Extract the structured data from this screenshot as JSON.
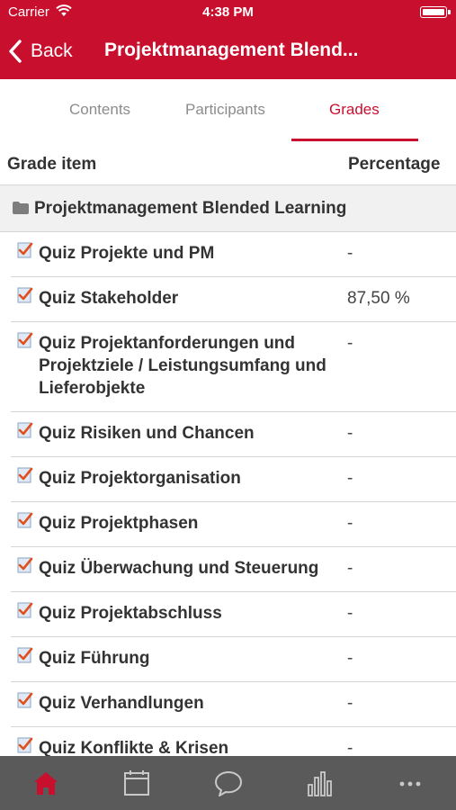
{
  "status_bar": {
    "carrier": "Carrier",
    "time": "4:38 PM"
  },
  "nav": {
    "back_label": "Back",
    "title": "Projektmanagement Blend..."
  },
  "tabs": [
    {
      "label": "Contents",
      "active": false
    },
    {
      "label": "Participants",
      "active": false
    },
    {
      "label": "Grades",
      "active": true
    }
  ],
  "table": {
    "col_item": "Grade item",
    "col_percentage": "Percentage"
  },
  "category": {
    "name": "Projektmanagement Blended Learning",
    "icon": "folder-icon"
  },
  "grade_items": [
    {
      "name": "Quiz Projekte und PM",
      "percentage": "-"
    },
    {
      "name": "Quiz Stakeholder",
      "percentage": "87,50 %"
    },
    {
      "name": "Quiz Projektanforderungen und Projektziele / Leistungsumfang und Lieferobjekte",
      "percentage": "-"
    },
    {
      "name": "Quiz Risiken und Chancen",
      "percentage": "-"
    },
    {
      "name": "Quiz Projektorganisation",
      "percentage": "-"
    },
    {
      "name": "Quiz Projektphasen",
      "percentage": "-"
    },
    {
      "name": "Quiz Überwachung und Steuerung",
      "percentage": "-"
    },
    {
      "name": "Quiz Projektabschluss",
      "percentage": "-"
    },
    {
      "name": "Quiz Führung",
      "percentage": "-"
    },
    {
      "name": "Quiz Verhandlungen",
      "percentage": "-"
    },
    {
      "name": "Quiz Konflikte & Krisen",
      "percentage": "-"
    }
  ],
  "bottom_tabs": [
    {
      "icon": "home-icon",
      "active": true
    },
    {
      "icon": "calendar-icon",
      "active": false
    },
    {
      "icon": "messages-icon",
      "active": false
    },
    {
      "icon": "grades-chart-icon",
      "active": false
    },
    {
      "icon": "more-icon",
      "active": false
    }
  ],
  "colors": {
    "brand": "#c8102e",
    "tabbar": "#5a5a5a",
    "category_bg": "#f1f1f1"
  }
}
